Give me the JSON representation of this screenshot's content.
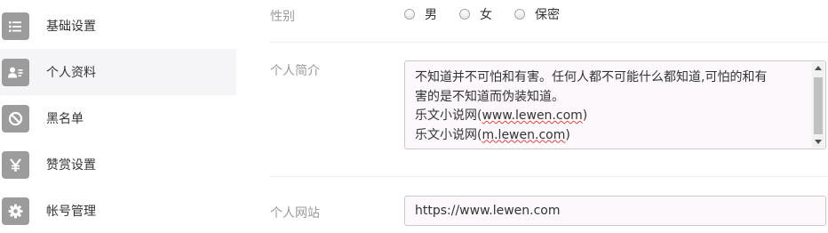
{
  "sidebar": {
    "items": [
      {
        "label": "基础设置",
        "icon": "list-icon"
      },
      {
        "label": "个人资料",
        "icon": "id-card-icon",
        "active": true
      },
      {
        "label": "黑名单",
        "icon": "ban-icon"
      },
      {
        "label": "赞赏设置",
        "icon": "yen-icon"
      },
      {
        "label": "帐号管理",
        "icon": "gear-icon"
      }
    ]
  },
  "form": {
    "gender": {
      "label": "性别",
      "options": [
        "男",
        "女",
        "保密"
      ]
    },
    "bio": {
      "label": "个人简介",
      "line1": "不知道并不可怕和有害。任何人都不可能什么都知道,可怕的和有",
      "line2": "害的是不知道而伪装知道。",
      "line3_prefix": "乐文小说网(",
      "line3_link": "www.lewen.com",
      "line3_suffix": ")",
      "line4_prefix": "乐文小说网(",
      "line4_link": "m.lewen.com",
      "line4_suffix": ")"
    },
    "website": {
      "label": "个人网站",
      "value": "https://www.lewen.com"
    }
  },
  "colors": {
    "icon_bg": "#9c9c9c",
    "active_bg": "#f5f4f7",
    "field_bg": "#fdf8fb"
  }
}
